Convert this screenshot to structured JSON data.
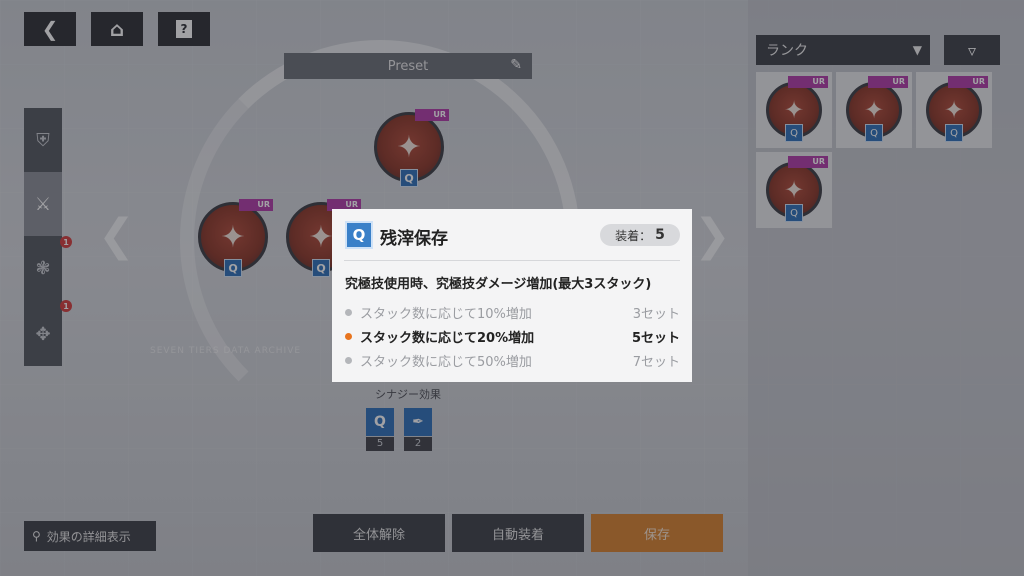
{
  "nav": {
    "back_icon": "chevron-left",
    "home_icon": "home",
    "help_label": "?"
  },
  "preset": {
    "label": "Preset"
  },
  "tabs": [
    {
      "icon": "shield",
      "active": false,
      "badge": ""
    },
    {
      "icon": "sword",
      "active": true,
      "badge": "1"
    },
    {
      "icon": "tree",
      "active": false,
      "badge": "1"
    },
    {
      "icon": "cross",
      "active": false,
      "badge": ""
    }
  ],
  "rune_badge": "UR",
  "rune_slot_icon": "Q",
  "faded_caption": "SEVEN TIERS DATA ARCHIVE",
  "synergy": {
    "title": "シナジー効果",
    "items": [
      {
        "icon": "Q",
        "count": "5"
      },
      {
        "icon": "pen",
        "count": "2"
      }
    ]
  },
  "buttons": {
    "detail": "効果の詳細表示",
    "unequip_all": "全体解除",
    "auto_equip": "自動装着",
    "save": "保存"
  },
  "right_panel": {
    "sort_label": "ランク",
    "cards": [
      {
        "badge": "UR",
        "icon": "Q"
      },
      {
        "badge": "UR",
        "icon": "Q"
      },
      {
        "badge": "UR",
        "icon": "Q"
      },
      {
        "badge": "UR",
        "icon": "Q"
      }
    ]
  },
  "popup": {
    "icon": "Q",
    "title": "残滓保存",
    "equip_label": "装着：",
    "equip_count": "5",
    "description": "究極技使用時、究極技ダメージ増加(最大3スタック)",
    "tiers": [
      {
        "text": "スタック数に応じて10%増加",
        "set": "3セット",
        "active": false
      },
      {
        "text": "スタック数に応じて20%増加",
        "set": "5セット",
        "active": true
      },
      {
        "text": "スタック数に応じて50%増加",
        "set": "7セット",
        "active": false
      }
    ]
  },
  "colors": {
    "accent_orange": "#e8741e",
    "ur_purple": "#b03aa8",
    "rune_red": "#8a3526",
    "slot_blue": "#2b6fb8"
  }
}
